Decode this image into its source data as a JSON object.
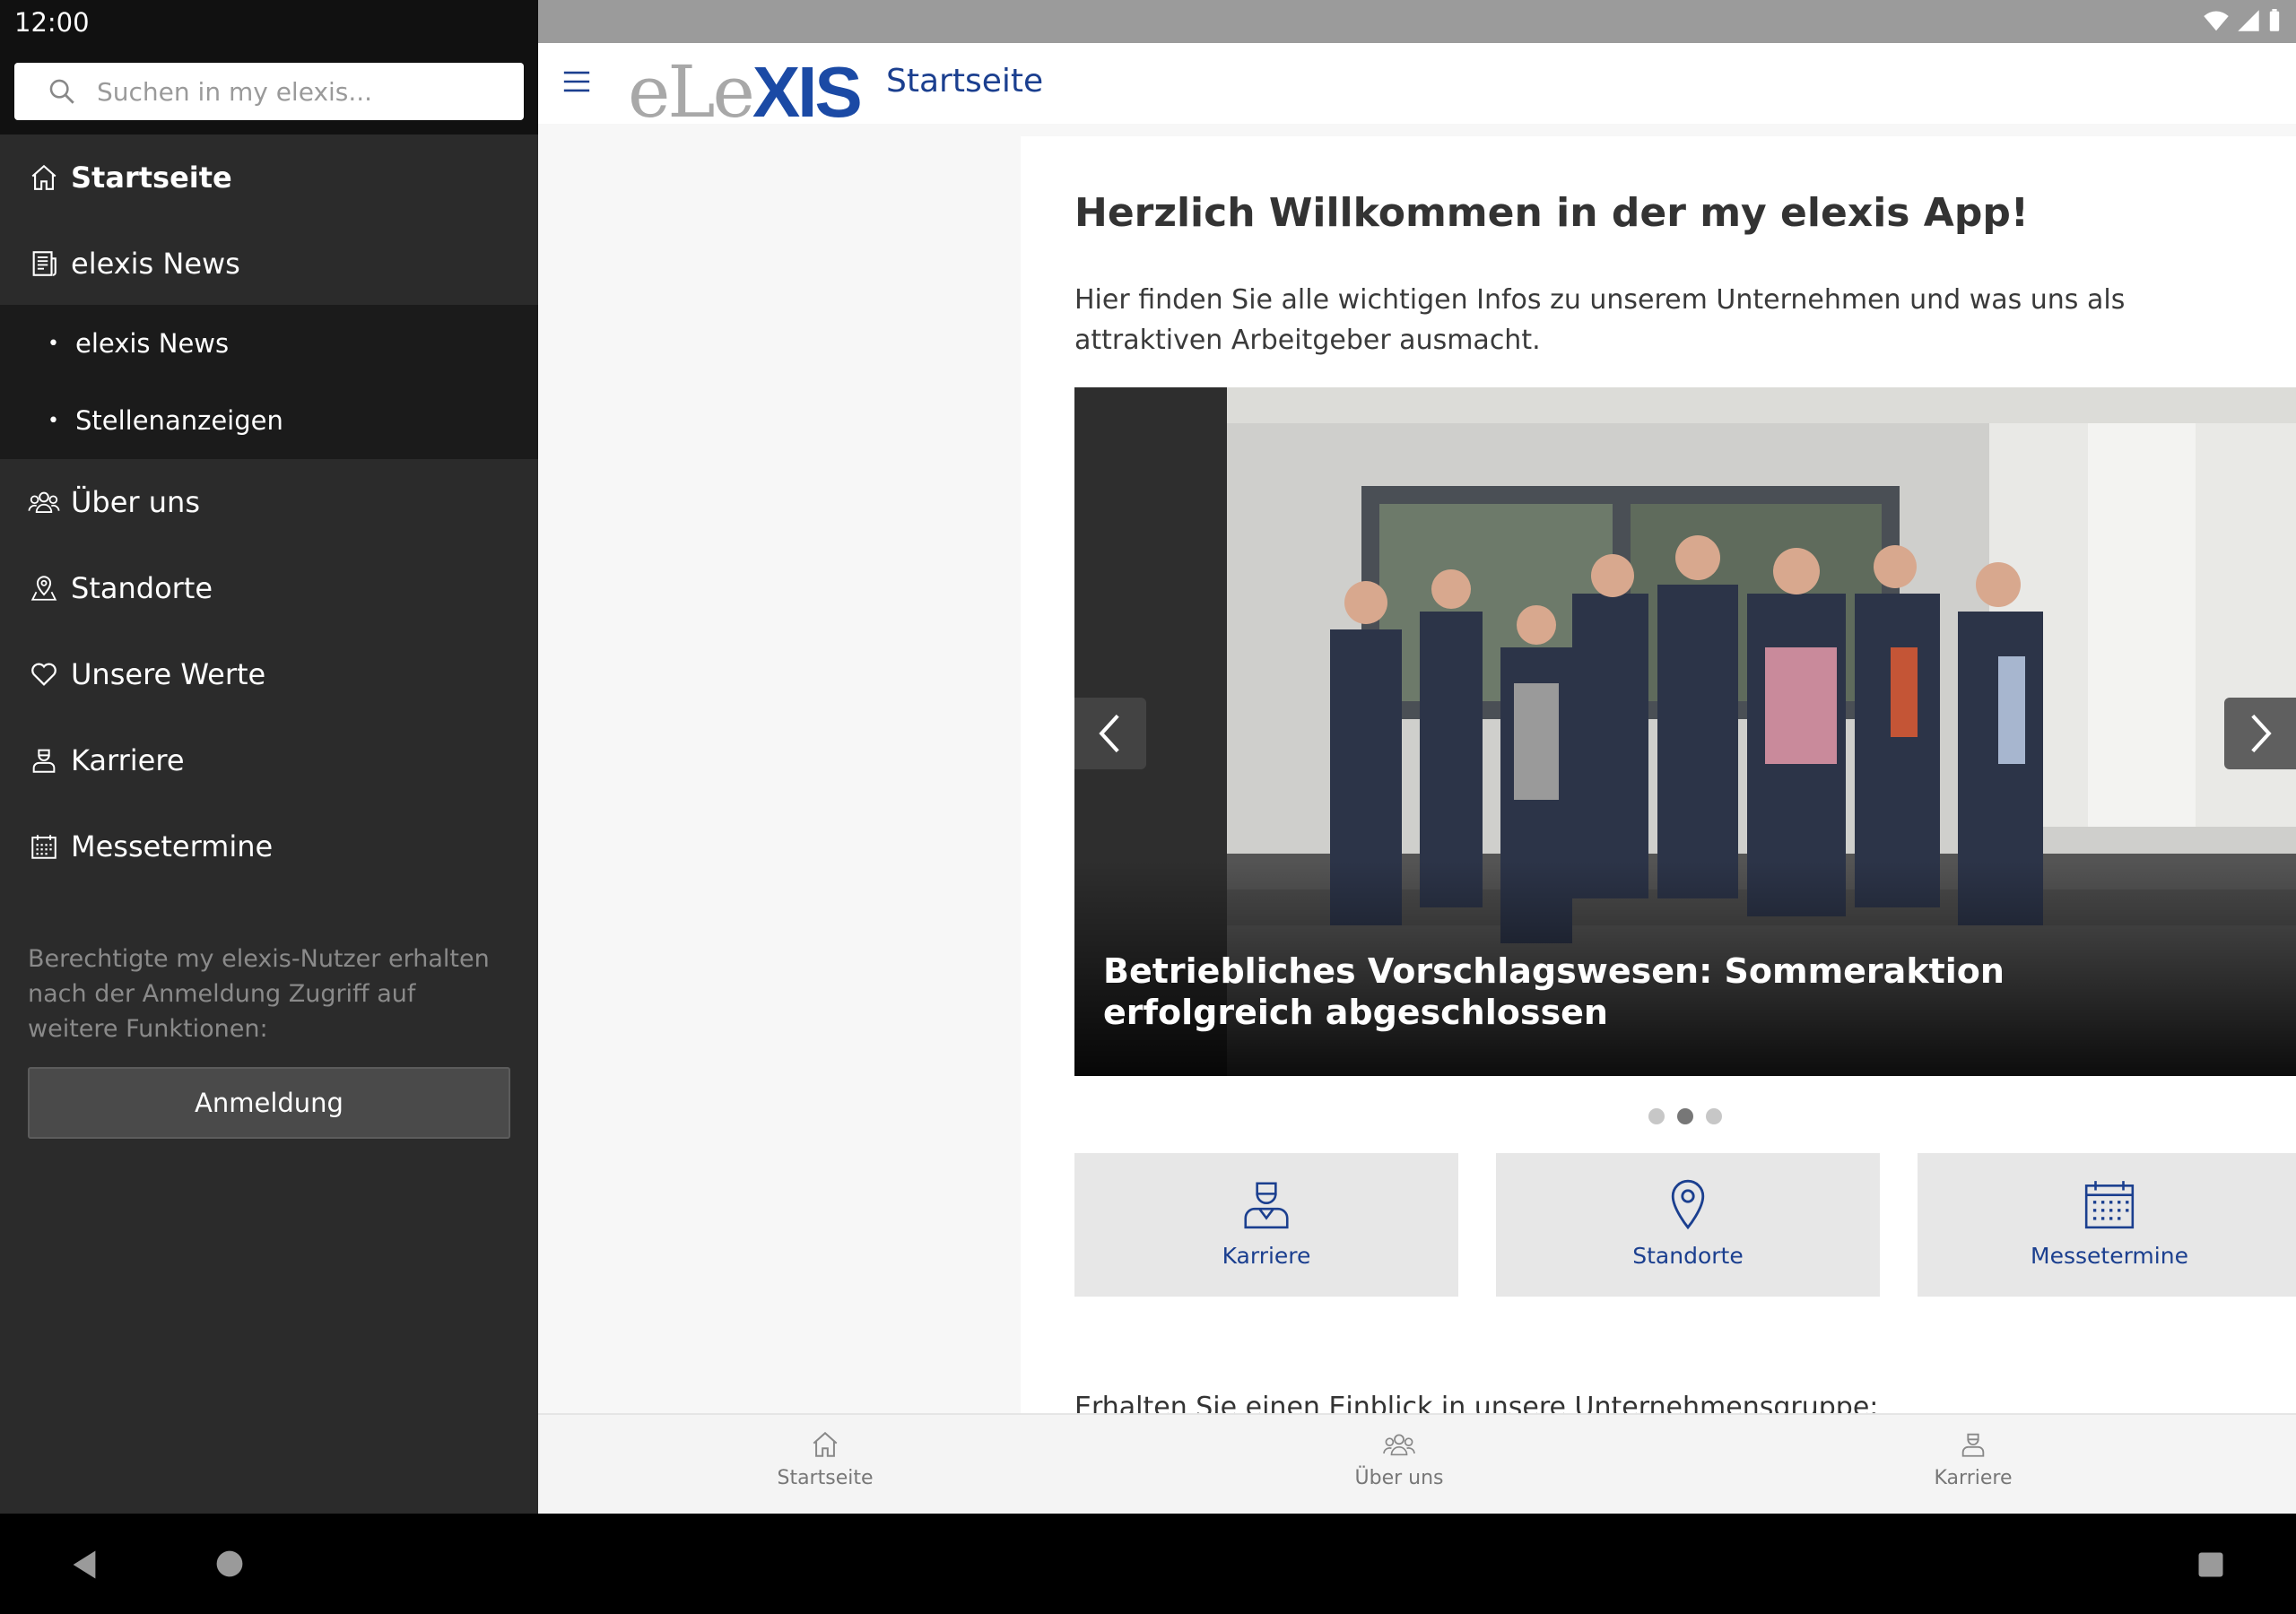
{
  "status": {
    "time": "12:00"
  },
  "search": {
    "placeholder": "Suchen in my elexis..."
  },
  "drawer": {
    "items": [
      {
        "label": "Startseite",
        "icon": "home-icon"
      },
      {
        "label": "elexis News",
        "icon": "newspaper-icon"
      },
      {
        "label": "Über uns",
        "icon": "team-icon"
      },
      {
        "label": "Standorte",
        "icon": "map-pin-icon"
      },
      {
        "label": "Unsere Werte",
        "icon": "heart-icon"
      },
      {
        "label": "Karriere",
        "icon": "worker-icon"
      },
      {
        "label": "Messetermine",
        "icon": "calendar-icon"
      }
    ],
    "subitems": [
      {
        "label": "elexis News"
      },
      {
        "label": "Stellenanzeigen"
      }
    ],
    "login_note": "Berechtigte my elexis-Nutzer erhalten nach der Anmeldung Zugriff auf weitere Funktionen:",
    "login_button": "Anmeldung"
  },
  "appbar": {
    "logo_el": "eLe",
    "logo_xis": "XIS",
    "title": "Startseite"
  },
  "main": {
    "welcome": "Herzlich Willkommen in der my elexis App!",
    "intro": "Hier finden Sie alle wichtigen Infos zu unserem Unternehmen und was uns als attraktiven Arbeitgeber ausmacht.",
    "carousel": {
      "caption": "Betriebliches Vorschlagswesen: Sommeraktion erfolgreich abgeschlossen",
      "active_slide": 2,
      "slide_count": 3
    },
    "tiles": [
      {
        "label": "Karriere",
        "icon": "worker-icon"
      },
      {
        "label": "Standorte",
        "icon": "map-pin-icon"
      },
      {
        "label": "Messetermine",
        "icon": "calendar-icon"
      }
    ],
    "insight": "Erhalten Sie einen Einblick in unsere Unternehmensgruppe:"
  },
  "bottom_nav": [
    {
      "label": "Startseite",
      "icon": "home-icon"
    },
    {
      "label": "Über uns",
      "icon": "team-icon"
    },
    {
      "label": "Karriere",
      "icon": "worker-icon"
    }
  ],
  "colors": {
    "brand_blue": "#1b3f8f",
    "drawer_bg": "#2b2b2b"
  }
}
